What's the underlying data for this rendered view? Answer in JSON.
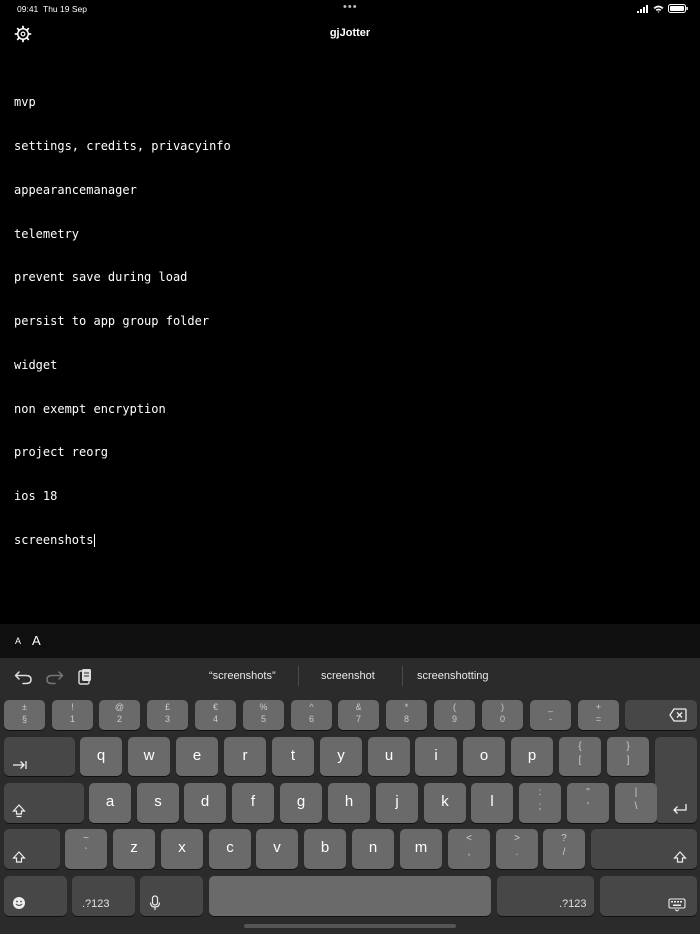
{
  "status": {
    "time": "09:41",
    "date": "Thu 19 Sep",
    "dots": "•••"
  },
  "nav": {
    "title": "gjJotter",
    "settings_icon": "gear-icon"
  },
  "editor": {
    "lines": [
      "mvp",
      "settings, credits, privacyinfo",
      "appearancemanager",
      "telemetry",
      "prevent save during load",
      "persist to app group folder",
      "widget",
      "non exempt encryption",
      "project reorg",
      "ios 18",
      "screenshots"
    ]
  },
  "fontbar": {
    "small": "A",
    "big": "A"
  },
  "toolbar": {
    "undo_icon": "undo-icon",
    "redo_icon": "redo-icon",
    "paste_icon": "clipboard-icon"
  },
  "suggestions": [
    "“screenshots”",
    "screenshot",
    "screenshotting"
  ],
  "keyboard": {
    "num_row": [
      {
        "top": "±",
        "bot": "§"
      },
      {
        "top": "!",
        "bot": "1"
      },
      {
        "top": "@",
        "bot": "2"
      },
      {
        "top": "£",
        "bot": "3"
      },
      {
        "top": "€",
        "bot": "4"
      },
      {
        "top": "%",
        "bot": "5"
      },
      {
        "top": "^",
        "bot": "6"
      },
      {
        "top": "&",
        "bot": "7"
      },
      {
        "top": "*",
        "bot": "8"
      },
      {
        "top": "(",
        "bot": "9"
      },
      {
        "top": ")",
        "bot": "0"
      },
      {
        "top": "_",
        "bot": "-"
      },
      {
        "top": "+",
        "bot": "="
      }
    ],
    "row1": [
      "q",
      "w",
      "e",
      "r",
      "t",
      "y",
      "u",
      "i",
      "o",
      "p"
    ],
    "row1_extra": [
      {
        "top": "{",
        "bot": "["
      },
      {
        "top": "}",
        "bot": "]"
      }
    ],
    "row2": [
      "a",
      "s",
      "d",
      "f",
      "g",
      "h",
      "j",
      "k",
      "l"
    ],
    "row2_extra": [
      {
        "top": ":",
        "bot": ";"
      },
      {
        "top": "\"",
        "bot": "'"
      },
      {
        "top": "|",
        "bot": "\\"
      }
    ],
    "row3_extra_left": {
      "top": "~",
      "bot": "`"
    },
    "row3": [
      "z",
      "x",
      "c",
      "v",
      "b",
      "n",
      "m"
    ],
    "row3_extra": [
      {
        "top": "<",
        "bot": ","
      },
      {
        "top": ">",
        "bot": "."
      },
      {
        "top": "?",
        "bot": "/"
      }
    ],
    "num_switch": ".?123"
  }
}
